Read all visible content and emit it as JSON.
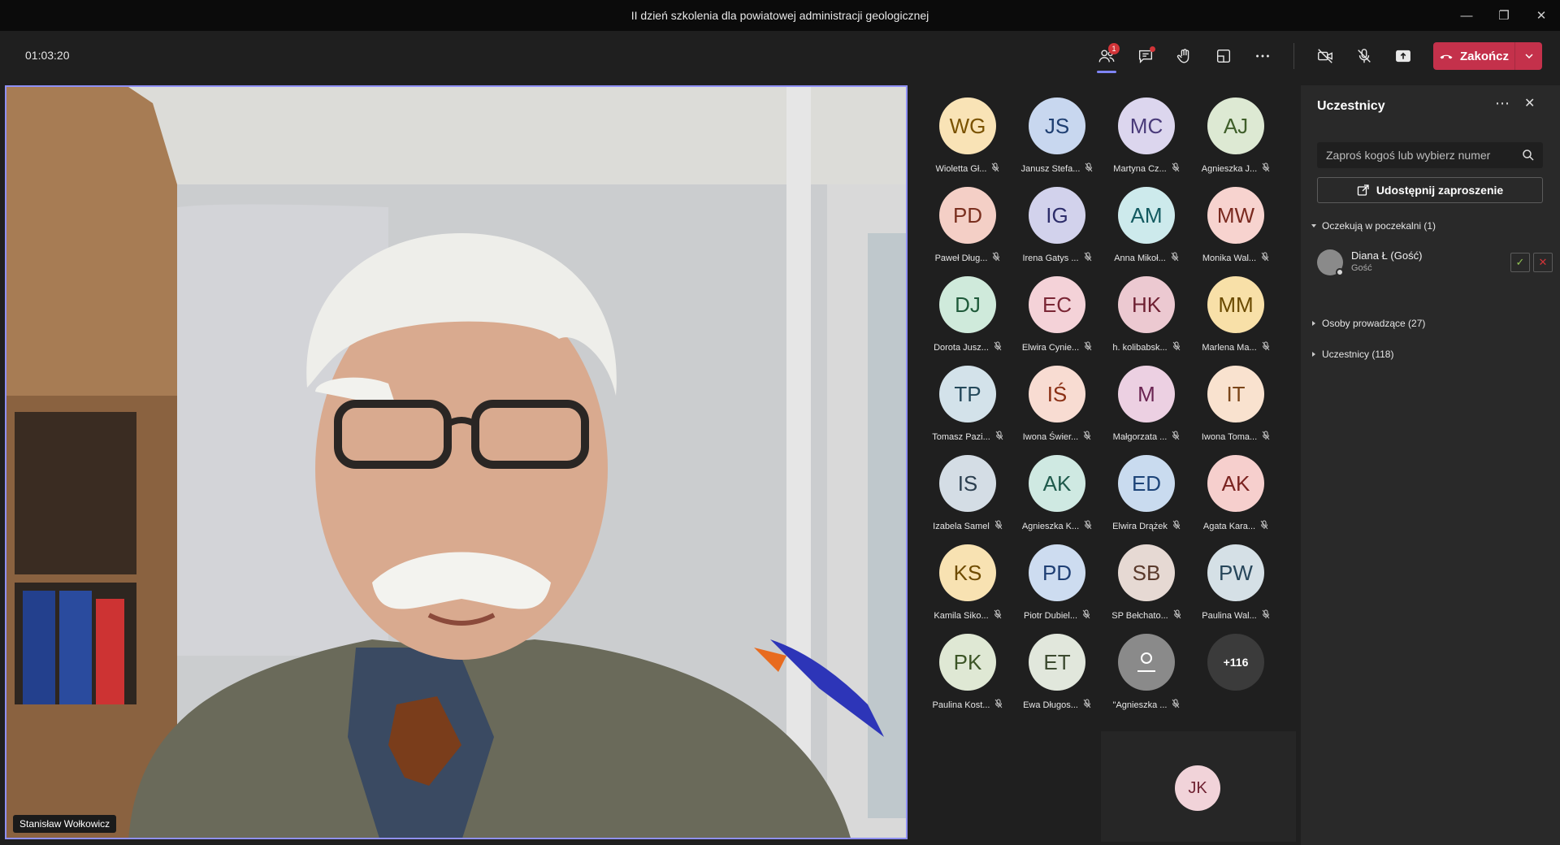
{
  "window": {
    "title": "II dzień szkolenia dla powiatowej administracji geologicznej"
  },
  "toolbar": {
    "timer": "01:03:20",
    "participants_badge": "1",
    "end_label": "Zakończ"
  },
  "stage": {
    "speaker_name": "Stanisław Wołkowicz"
  },
  "grid": [
    {
      "initials": "WG",
      "name": "Wioletta Gł...",
      "bg": "#f9e3b6",
      "fg": "#7a5200"
    },
    {
      "initials": "JS",
      "name": "Janusz Stefa...",
      "bg": "#c8d7ef",
      "fg": "#1f3f72"
    },
    {
      "initials": "MC",
      "name": "Martyna Cz...",
      "bg": "#dcd6ee",
      "fg": "#4a3b7a"
    },
    {
      "initials": "AJ",
      "name": "Agnieszka J...",
      "bg": "#dde9d3",
      "fg": "#3f5e2a"
    },
    {
      "initials": "PD",
      "name": "Paweł Dług...",
      "bg": "#f4cfc6",
      "fg": "#7a2f1f"
    },
    {
      "initials": "IG",
      "name": "Irena Gatys ...",
      "bg": "#d2d2ec",
      "fg": "#2d2d6a"
    },
    {
      "initials": "AM",
      "name": "Anna Mikoł...",
      "bg": "#cdeaec",
      "fg": "#135a60"
    },
    {
      "initials": "MW",
      "name": "Monika Wal...",
      "bg": "#f7d3cf",
      "fg": "#7a2a20"
    },
    {
      "initials": "DJ",
      "name": "Dorota Jusz...",
      "bg": "#cfeadb",
      "fg": "#1f5a3a"
    },
    {
      "initials": "EC",
      "name": "Elwira Cynie...",
      "bg": "#f4d2d8",
      "fg": "#7a2635"
    },
    {
      "initials": "HK",
      "name": "h. kolibabsk...",
      "bg": "#ecc9d1",
      "fg": "#6d1f31"
    },
    {
      "initials": "MM",
      "name": "Marlena Ma...",
      "bg": "#f8e0a8",
      "fg": "#6a4a00"
    },
    {
      "initials": "TP",
      "name": "Tomasz Pazi...",
      "bg": "#d3e2ea",
      "fg": "#24485a"
    },
    {
      "initials": "IŚ",
      "name": "Iwona Świer...",
      "bg": "#f8dcd2",
      "fg": "#8a2f14"
    },
    {
      "initials": "M",
      "name": "Małgorzata ...",
      "bg": "#ecd0e2",
      "fg": "#6a2452"
    },
    {
      "initials": "IT",
      "name": "Iwona Toma...",
      "bg": "#f9e2cf",
      "fg": "#7a4519"
    },
    {
      "initials": "IS",
      "name": "Izabela Samel",
      "bg": "#d4dde5",
      "fg": "#2c3f4f"
    },
    {
      "initials": "AK",
      "name": "Agnieszka K...",
      "bg": "#cfe9e2",
      "fg": "#1f5a4c"
    },
    {
      "initials": "ED",
      "name": "Elwira Drążek",
      "bg": "#c9dbef",
      "fg": "#1d4478"
    },
    {
      "initials": "AK",
      "name": "Agata Kara...",
      "bg": "#f6cfcd",
      "fg": "#7a2320"
    },
    {
      "initials": "KS",
      "name": "Kamila Siko...",
      "bg": "#f8e2b2",
      "fg": "#6e4b00"
    },
    {
      "initials": "PD",
      "name": "Piotr Dubiel...",
      "bg": "#cddcf0",
      "fg": "#1f3f74"
    },
    {
      "initials": "SB",
      "name": "SP Bełchato...",
      "bg": "#e6d9d3",
      "fg": "#5a3a2c"
    },
    {
      "initials": "PW",
      "name": "Paulina Wal...",
      "bg": "#d5e0e6",
      "fg": "#27465a"
    },
    {
      "initials": "PK",
      "name": "Paulina Kost...",
      "bg": "#dfe8d4",
      "fg": "#3c5526"
    },
    {
      "initials": "ET",
      "name": "Ewa Długos...",
      "bg": "#e1e7dc",
      "fg": "#3c4a30"
    },
    {
      "initials": "",
      "name": "\"Agnieszka ...",
      "bg": "#8a8a8a",
      "fg": "#ffffff"
    },
    {
      "initials": "+116",
      "name": "",
      "bg": "#3b3b3b",
      "fg": "#ffffff"
    }
  ],
  "self_view": {
    "initials": "JK"
  },
  "panel": {
    "title": "Uczestnicy",
    "search_placeholder": "Zaproś kogoś lub wybierz numer",
    "share_label": "Udostępnij zaproszenie",
    "lobby_header": "Oczekują w poczekalni (1)",
    "lobby_name": "Diana Ł (Gość)",
    "lobby_role": "Gość",
    "presenters_header": "Osoby prowadzące (27)",
    "attendees_header": "Uczestnicy (118)"
  }
}
